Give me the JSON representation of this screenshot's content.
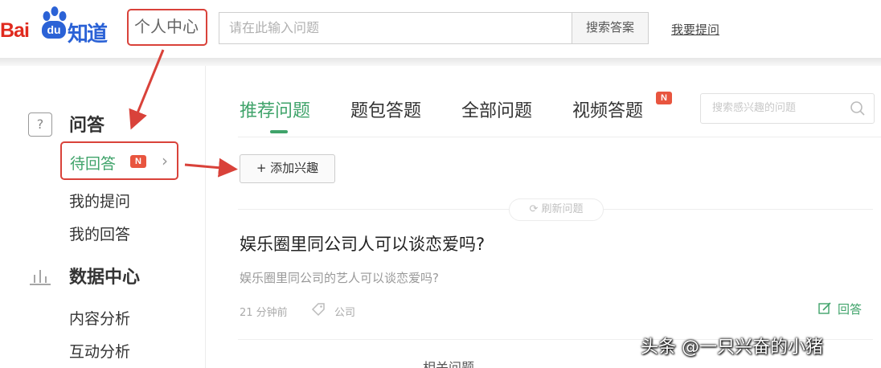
{
  "header": {
    "logo_bai": "Bai",
    "logo_du": "du",
    "logo_zhidao": "知道",
    "personal_center": "个人中心",
    "search_placeholder": "请在此输入问题",
    "search_button": "搜索答案",
    "ask_link": "我要提问"
  },
  "sidebar": {
    "qa_icon_glyph": "?",
    "qa_title": "问答",
    "pending": {
      "label": "待回答",
      "badge": "N",
      "chevron": "›"
    },
    "my_questions": "我的提问",
    "my_answers": "我的回答",
    "data_title": "数据中心",
    "content_analysis": "内容分析",
    "interaction_analysis": "互动分析"
  },
  "main": {
    "tabs": [
      {
        "label": "推荐问题",
        "active": true
      },
      {
        "label": "题包答题",
        "active": false
      },
      {
        "label": "全部问题",
        "active": false
      },
      {
        "label": "视频答题",
        "active": false,
        "badge": "N"
      }
    ],
    "topic_search_placeholder": "搜索感兴趣的问题",
    "add_interest": "+ 添加兴趣",
    "refresh": "刷新问题",
    "question": {
      "title": "娱乐圈里同公司人可以谈恋爱吗?",
      "description": "娱乐圈里同公司的艺人可以谈恋爱吗?",
      "time": "21 分钟前",
      "tag": "公司",
      "answer": "回答"
    },
    "next_peek": "相关问题"
  },
  "annotations": {
    "color": "#d9423a",
    "accent": "#3fa36a"
  },
  "watermark": "头条 @一只兴奋的小猪"
}
